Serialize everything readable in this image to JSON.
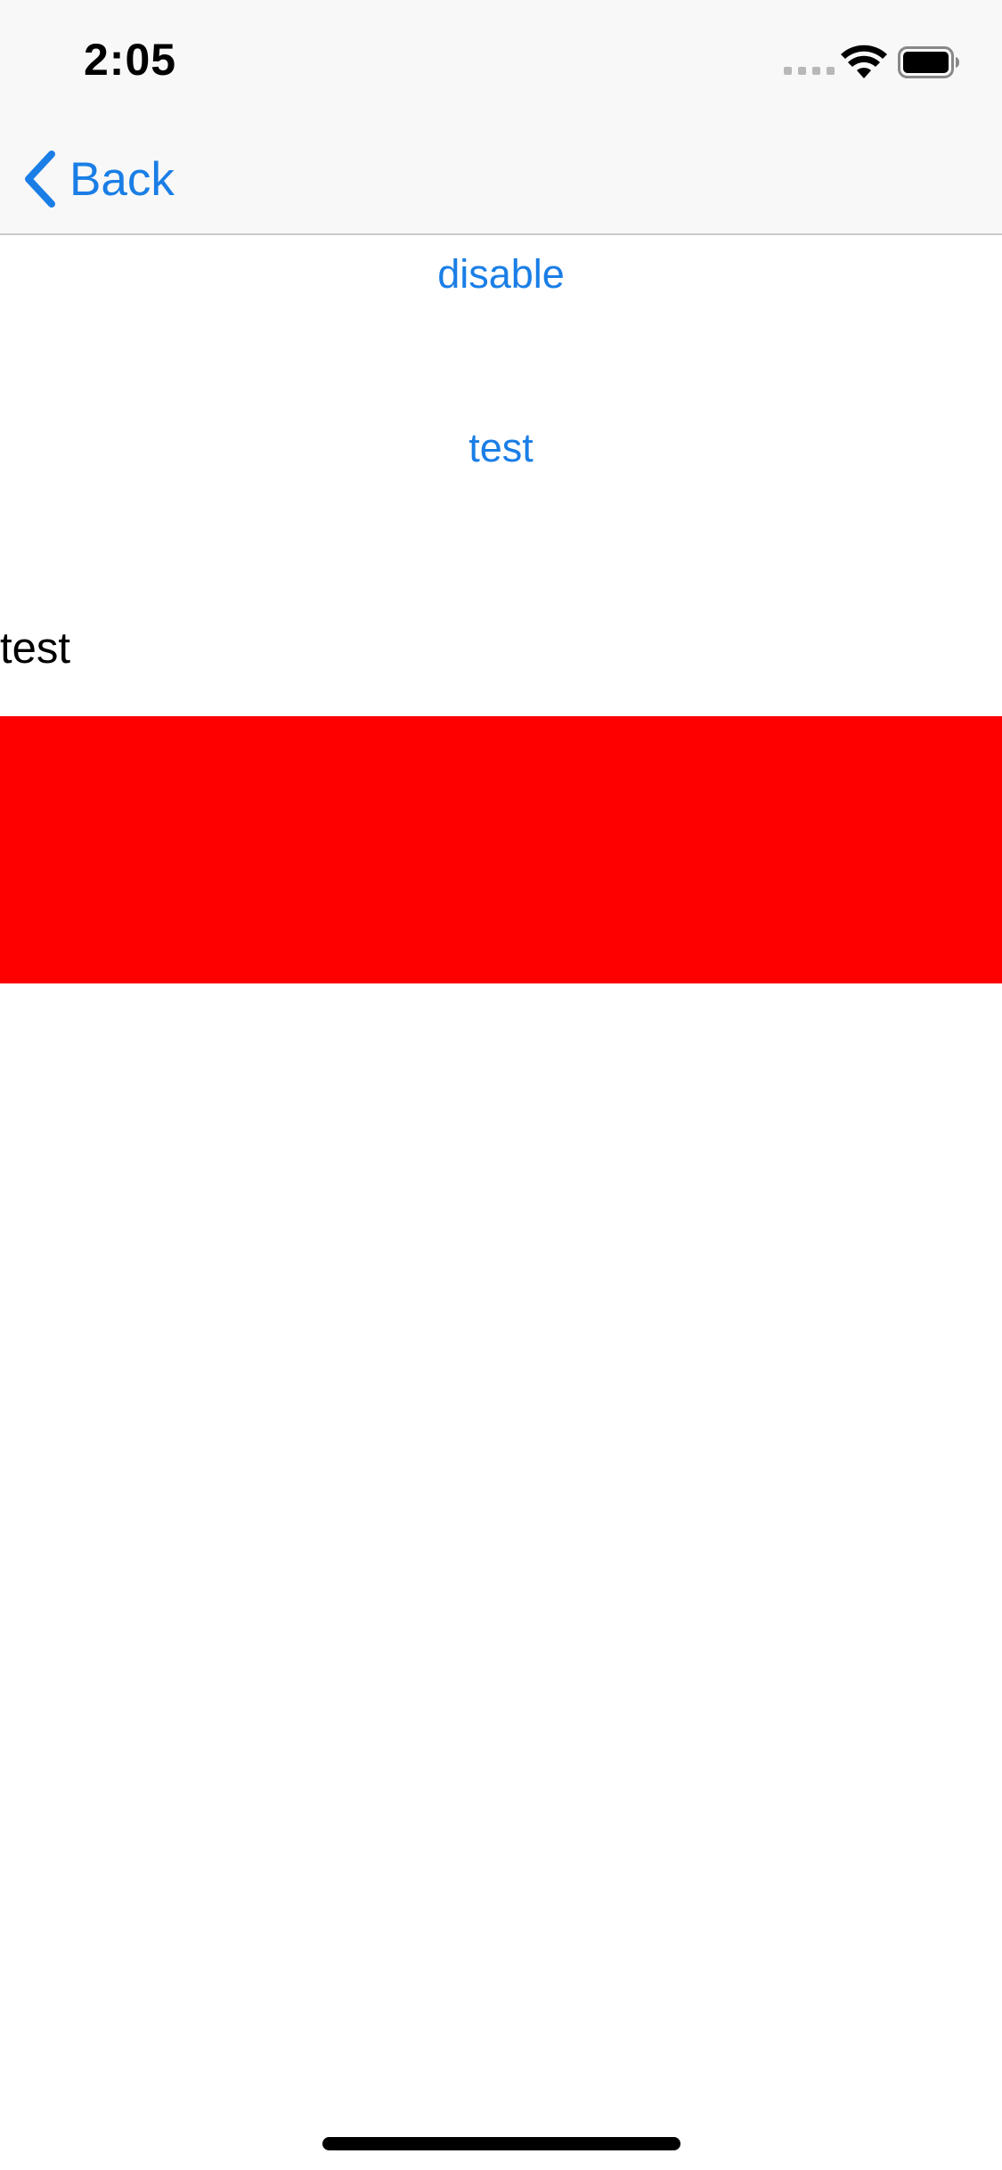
{
  "status_bar": {
    "time": "2:05",
    "signal_icon": "signal-dots-icon",
    "wifi_icon": "wifi-icon",
    "battery_icon": "battery-icon"
  },
  "nav": {
    "back_label": "Back",
    "back_icon": "chevron-left-icon"
  },
  "content": {
    "disable_label": "disable",
    "test_button_label": "test",
    "test_text": "test",
    "red_block_color": "#ff0000"
  },
  "colors": {
    "accent": "#1a7ee6",
    "nav_background": "#f8f8f8",
    "background": "#ffffff"
  }
}
